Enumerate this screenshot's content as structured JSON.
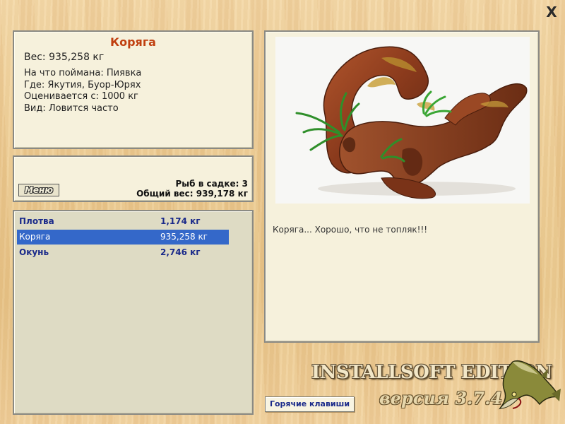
{
  "window": {
    "close_glyph": "X",
    "close_icon": "close-icon"
  },
  "catch_info": {
    "title": "Коряга",
    "weight": "Вес: 935,258 кг",
    "bait": "На что поймана: Пиявка",
    "location": "Где: Якутия, Буор-Юрях",
    "valued_from": "Оценивается с: 1000 кг",
    "kind": "Вид: Ловится часто"
  },
  "summary": {
    "menu_label": "Меню",
    "fish_in_keepnet": "Рыб в садке: 3",
    "total_weight": "Общий вес: 939,178 кг"
  },
  "fish_list": [
    {
      "name": "Плотва",
      "weight": "1,174 кг",
      "selected": false
    },
    {
      "name": "Коряга",
      "weight": "935,258 кг",
      "selected": true
    },
    {
      "name": "Окунь",
      "weight": "2,746 кг",
      "selected": false
    }
  ],
  "detail": {
    "image_icon": "driftwood-image",
    "comment": "Коряга... Хорошо, что не топляк!!!"
  },
  "branding": {
    "edition": "INSTALLSOFT EDITION",
    "version": "версия 3.7.4",
    "logo_icon": "pike-fish-logo"
  },
  "hotkeys_label": "Горячие клавиши",
  "colors": {
    "title": "#c04010",
    "selection": "#3468c9",
    "list_text": "#1a2a8a",
    "panel_bg": "#f6f1dc"
  }
}
